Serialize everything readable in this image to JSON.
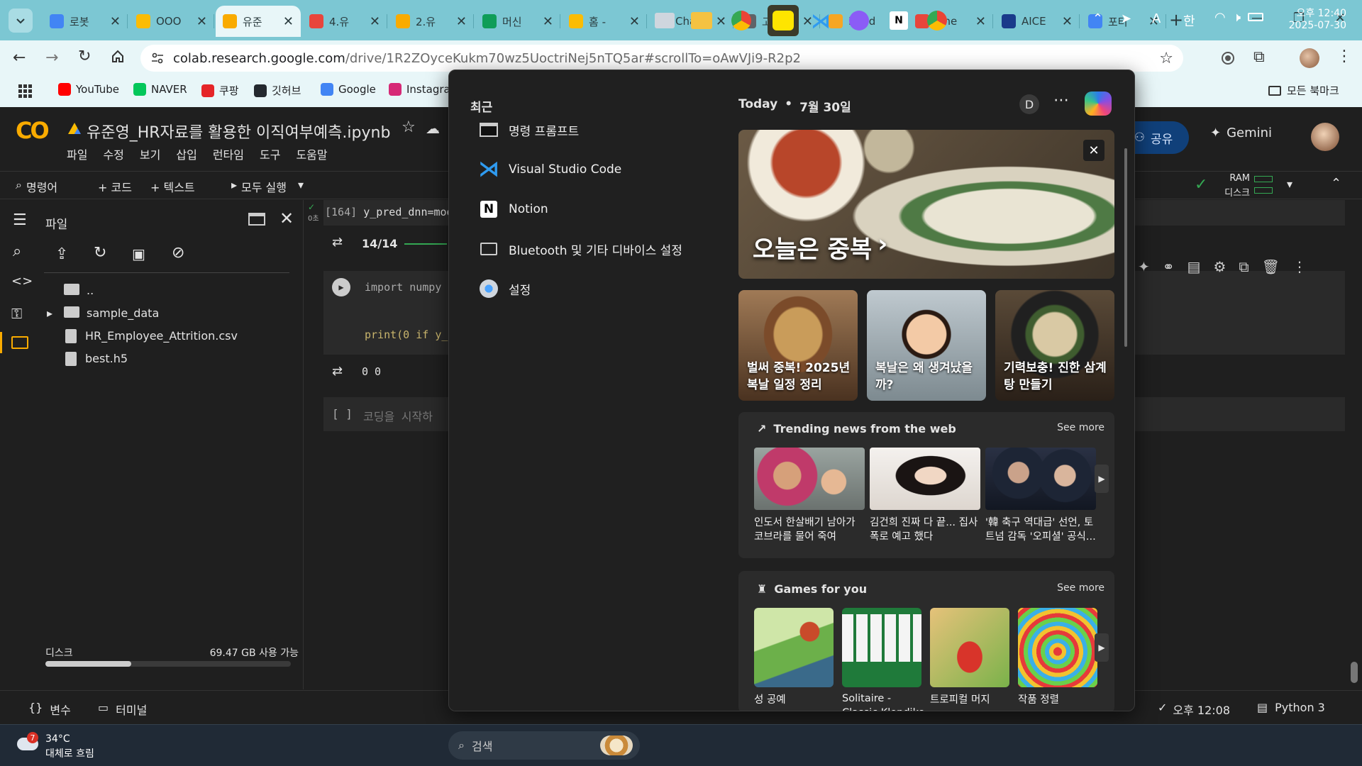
{
  "browser": {
    "tabs": [
      {
        "title": "로봇",
        "color": "#4285f4"
      },
      {
        "title": "OOO",
        "color": "#fbbc04"
      },
      {
        "title": "유준",
        "color": "#f9ab00"
      },
      {
        "title": "4.유",
        "color": "#e8453c"
      },
      {
        "title": "2.유",
        "color": "#f9ab00"
      },
      {
        "title": "머신",
        "color": "#0f9d58"
      },
      {
        "title": "홈 -",
        "color": "#fbbc04"
      },
      {
        "title": "Chat",
        "color": "#111111"
      },
      {
        "title": "고객",
        "color": "#5f6368"
      },
      {
        "title": "Rand",
        "color": "#f6a623"
      },
      {
        "title": "Line",
        "color": "#e8453c"
      },
      {
        "title": "AICE",
        "color": "#1a3a8a"
      },
      {
        "title": "포터",
        "color": "#4285f4"
      }
    ],
    "new_tab": "+",
    "url_host": "colab.research.google.com",
    "url_path": "/drive/1R2ZOyceKukm70wz5UoctriNej5nTQ5ar#scrollTo=oAwVJi9-R2p2",
    "bookmarks": [
      {
        "label": "YouTube",
        "color": "#ff0000"
      },
      {
        "label": "NAVER",
        "color": "#03c75a"
      },
      {
        "label": "쿠팡",
        "color": "#e52528"
      },
      {
        "label": "깃허브",
        "color": "#24292f"
      },
      {
        "label": "Google",
        "color": "#4285f4"
      },
      {
        "label": "Instagram",
        "color": "#d62976"
      }
    ],
    "all_bookmarks": "모든 북마크"
  },
  "colab": {
    "logo": "CO",
    "notebook_title": "유준영_HR자료를 활용한 이직여부예측.ipynb",
    "menu": [
      "파일",
      "수정",
      "보기",
      "삽입",
      "런타임",
      "도구",
      "도움말"
    ],
    "toolbar": {
      "command": "명령어",
      "code": "+ 코드",
      "text": "+ 텍스트",
      "run_all": "모두 실행"
    },
    "share": "공유",
    "gemini": "Gemini",
    "ram_label": "RAM",
    "disk_label": "디스크",
    "files_panel": {
      "title": "파일",
      "items": [
        "..",
        "sample_data",
        "HR_Employee_Attrition.csv",
        "best.h5"
      ],
      "disk_label": "디스크",
      "disk_usage": "69.47 GB 사용 가능",
      "disk_fraction": 0.35
    },
    "cells": {
      "exec_index": "[164]",
      "exec_code": "y_pred_dnn=mod",
      "exec_time": "0초",
      "progress": "14/14",
      "code_line1": "import numpy",
      "code_line2": "print(0 if y_",
      "output": "0 0",
      "empty_prompt": "[ ]",
      "empty_placeholder": "코딩을 시작하"
    },
    "status": {
      "vars": "변수",
      "terminal": "터미널",
      "time": "오후 12:08",
      "runtime": "Python 3"
    }
  },
  "widget": {
    "recent_title": "최근",
    "recent": [
      {
        "label": "명령 프롬프트",
        "icon": "terminal-icon"
      },
      {
        "label": "Visual Studio Code",
        "icon": "vscode-icon"
      },
      {
        "label": "Notion",
        "icon": "notion-icon"
      },
      {
        "label": "Bluetooth 및 기타 디바이스 설정",
        "icon": "bluetooth-devices-icon"
      },
      {
        "label": "설정",
        "icon": "settings-gear-icon"
      }
    ],
    "today": "Today",
    "date": "7월 30일",
    "avatar_letter": "D",
    "hero_caption": "오늘은 중복",
    "cards": [
      "벌써 중복! 2025년 복날 일정 정리",
      "복날은 왜 생겨났을까?",
      "기력보충! 진한 삼계탕 만들기"
    ],
    "trending_title": "Trending news from the web",
    "see_more": "See more",
    "news": [
      "인도서 한살배기 남아가 코브라를 물어 죽여",
      "김건희 진짜 다 끝... 집사 폭로 예고 했다",
      "'韓 축구 역대급' 선언, 토트넘 감독 '오피셜' 공식..."
    ],
    "games_title": "Games for you",
    "games": [
      "성 공예",
      "Solitaire - Classic Klondike",
      "트로피컬 머지",
      "작품 정렬"
    ]
  },
  "taskbar": {
    "weather_temp": "34°C",
    "weather_desc": "대체로 흐림",
    "weather_badge": "7",
    "search_placeholder": "검색",
    "ime_a": "A",
    "ime_han": "한",
    "clock_time": "오후 12:40",
    "clock_date": "2025-07-30"
  }
}
